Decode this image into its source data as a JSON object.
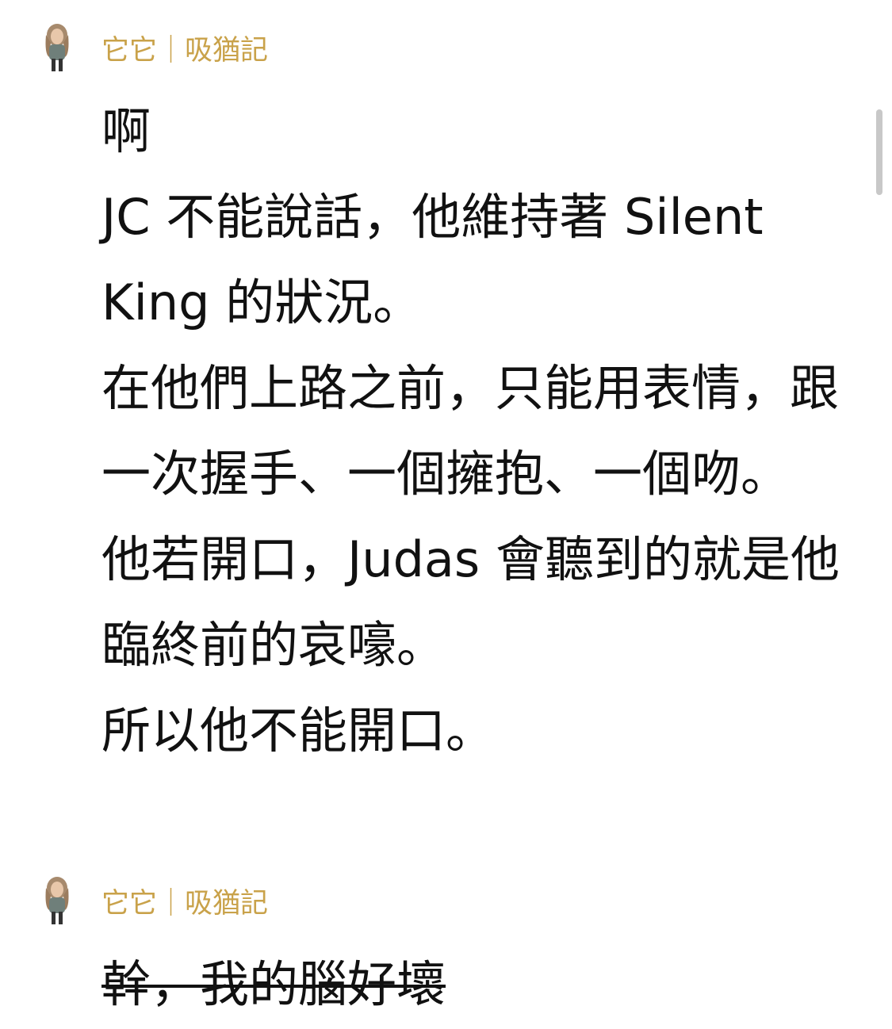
{
  "messages": [
    {
      "author": "它它｜吸猶記",
      "avatar_icon": "long-haired-person-avatar",
      "text": "啊\nJC 不能說話，他維持著 Silent King 的狀況。\n在他們上路之前，只能用表情，跟一次握手、一個擁抱、一個吻。\n他若開口，Judas 會聽到的就是他臨終前的哀嚎。\n所以他不能開口。"
    },
    {
      "author": "它它｜吸猶記",
      "avatar_icon": "long-haired-person-avatar",
      "text": "幹，我的腦好壞",
      "strikethrough": true
    }
  ],
  "colors": {
    "author": "#c9a24a",
    "text": "#111111",
    "background": "#ffffff",
    "scrollbar": "#c8c8c8"
  }
}
